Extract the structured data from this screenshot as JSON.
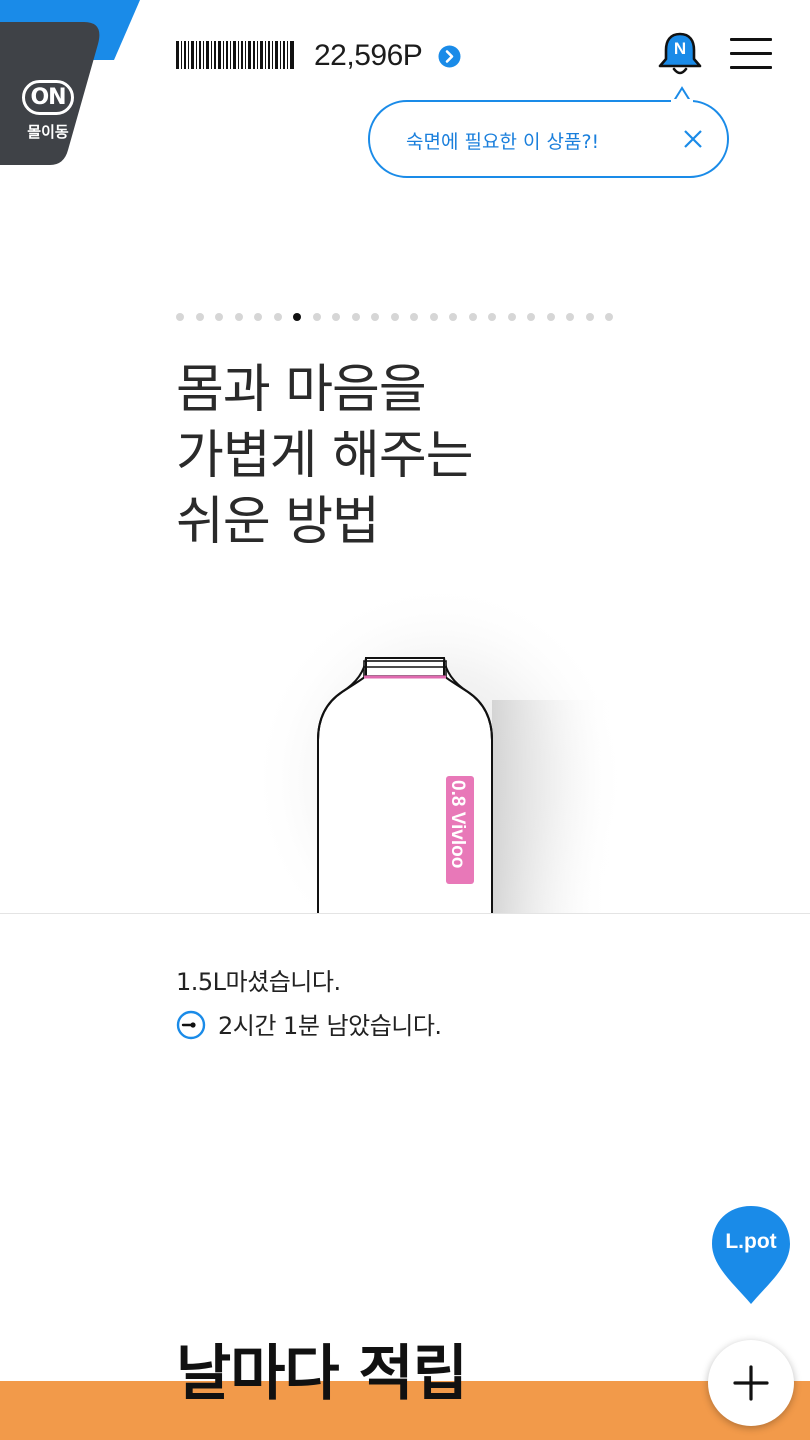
{
  "mall": {
    "badge_text": "ON",
    "label": "몰이동",
    "accent_color": "#1a8be8",
    "badge_color": "#3f4247"
  },
  "header": {
    "points": "22,596P",
    "notification_badge": "N",
    "icons": [
      "barcode-icon",
      "chevron-right-icon",
      "bell-icon",
      "menu-icon"
    ]
  },
  "tooltip": {
    "message": "숙면에 필요한 이 상품?!"
  },
  "carousel": {
    "total": 23,
    "active_index": 6
  },
  "hero": {
    "lines": [
      "몸과 마음을",
      "가볍게 해주는",
      "쉬운 방법"
    ],
    "bottle_label": "0.8 Vivloo"
  },
  "status": {
    "drunk": "1.5L마셨습니다.",
    "remaining": "2시간 1분 남았습니다."
  },
  "lpot": {
    "label": "L.pot"
  },
  "section": {
    "title": "날마다 적립",
    "bar_color": "#f29a4a"
  }
}
